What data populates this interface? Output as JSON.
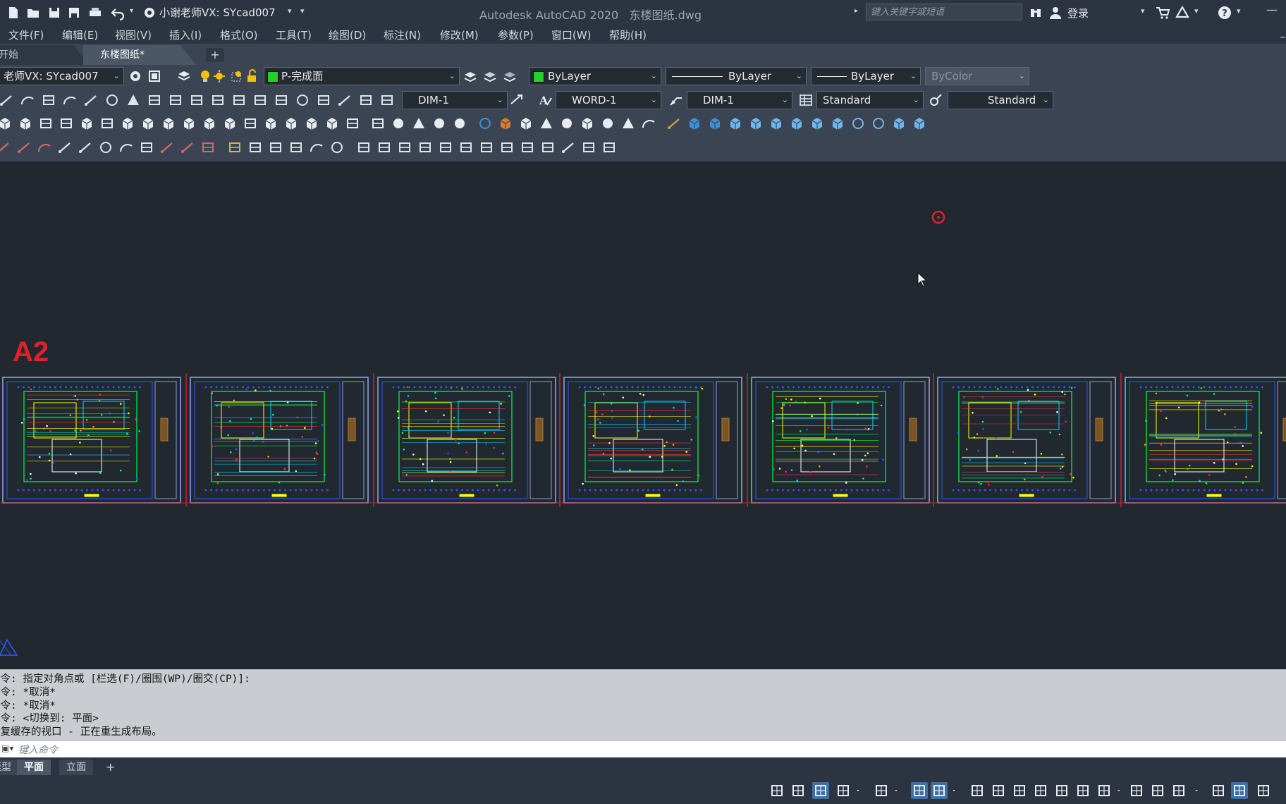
{
  "titlebar": {
    "app_title": "Autodesk AutoCAD 2020",
    "file_name": "东楼图纸.dwg",
    "workspace": "小谢老师VX: SYcad007",
    "search_placeholder": "键入关键字或短语",
    "login": "登录"
  },
  "menu": [
    "文件(F)",
    "编辑(E)",
    "视图(V)",
    "插入(I)",
    "格式(O)",
    "工具(T)",
    "绘图(D)",
    "标注(N)",
    "修改(M)",
    "参数(P)",
    "窗口(W)",
    "帮助(H)"
  ],
  "tabs": {
    "start": "开始",
    "active": "东楼图纸*"
  },
  "toolbar": {
    "workspace_dropdown": "老师VX: SYcad007",
    "layer": "P-完成面",
    "color": "ByLayer",
    "linetype": "ByLayer",
    "lineweight": "ByLayer",
    "plotstyle": "ByColor",
    "dim_style": "DIM-1",
    "text_style": "WORD-1",
    "mleader_style": "DIM-1",
    "table_style": "Standard",
    "multileader_style": "Standard"
  },
  "canvas": {
    "sheet_label": "A2",
    "sheet_count": 7
  },
  "command_history": [
    "命令: 指定对角点或 [栏选(F)/圈围(WP)/圈交(CP)]:",
    "命令: *取消*",
    "命令: *取消*",
    "命令:  <切换到: 平面>",
    "恢复缓存的视口 - 正在重生成布局。"
  ],
  "command_input_placeholder": "键入命令",
  "layout_tabs": [
    "模型",
    "平面",
    "立面"
  ],
  "active_layout": "平面",
  "colors": {
    "background": "#212830",
    "toolbar": "#3a4452",
    "accent_red": "#e0202a",
    "status_active": "#3f8fd6"
  }
}
